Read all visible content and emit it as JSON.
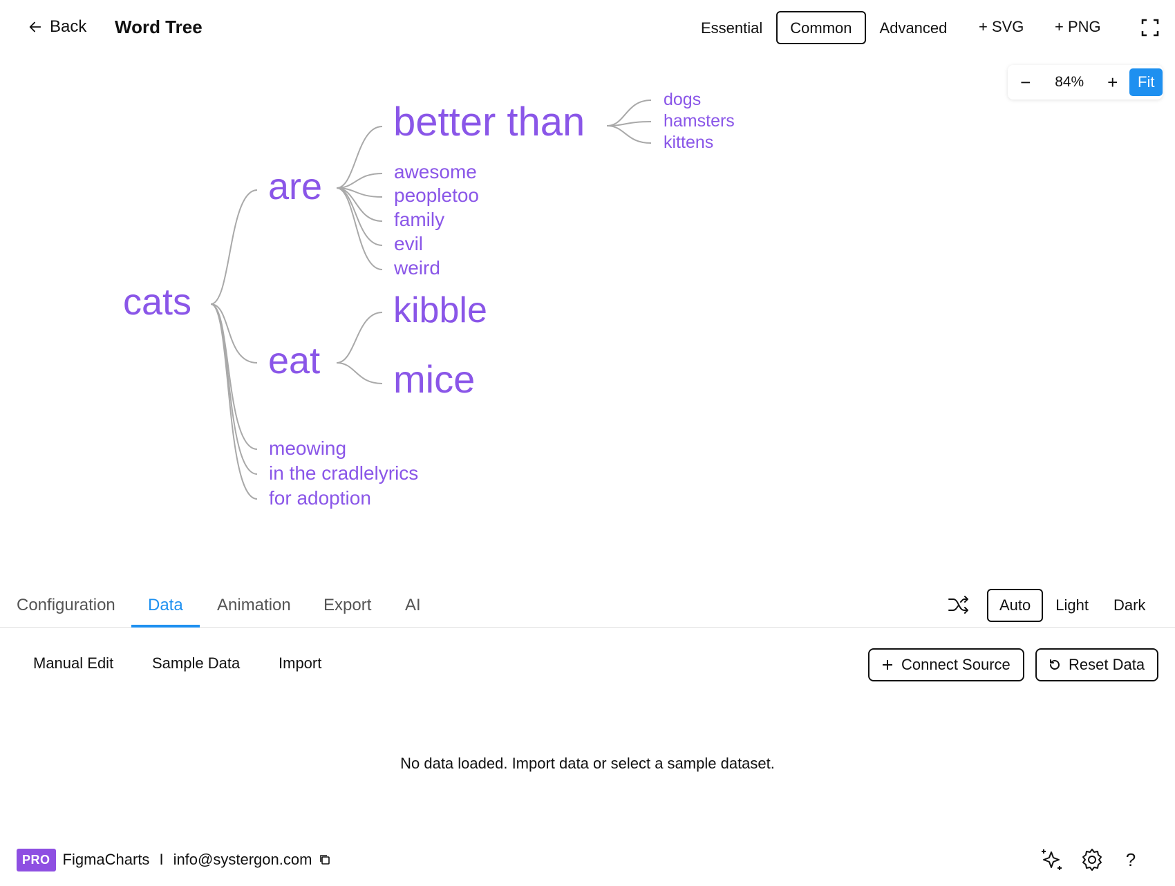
{
  "header": {
    "back_label": "Back",
    "title": "Word Tree",
    "modes": [
      "Essential",
      "Common",
      "Advanced"
    ],
    "active_mode": "Common",
    "export_svg": "+ SVG",
    "export_png": "+ PNG"
  },
  "zoom": {
    "minus": "−",
    "level": "84%",
    "plus": "+",
    "fit": "Fit"
  },
  "word_tree": {
    "root": "cats",
    "level1": [
      "are",
      "eat",
      "meowing",
      "in the cradlelyrics",
      "for adoption"
    ],
    "are_children": [
      "better than",
      "awesome",
      "peopletoo",
      "family",
      "evil",
      "weird"
    ],
    "better_than_children": [
      "dogs",
      "hamsters",
      "kittens"
    ],
    "eat_children": [
      "kibble",
      "mice"
    ],
    "text_color": "#8a56e8",
    "branch_color": "#a9a9a9"
  },
  "tabs": {
    "items": [
      "Configuration",
      "Data",
      "Animation",
      "Export",
      "AI"
    ],
    "active": "Data"
  },
  "theme": {
    "items": [
      "Auto",
      "Light",
      "Dark"
    ],
    "active": "Auto"
  },
  "data_panel": {
    "subtabs": [
      "Manual Edit",
      "Sample Data",
      "Import"
    ],
    "connect_source": "Connect Source",
    "reset_data": "Reset Data",
    "empty_message": "No data loaded. Import data or select a sample dataset."
  },
  "footer": {
    "badge": "PRO",
    "app_name": "FigmaCharts",
    "separator": "I",
    "email": "info@systergon.com"
  },
  "colors": {
    "accent": "#1e90f0",
    "pro_badge": "#8e4fe2"
  }
}
